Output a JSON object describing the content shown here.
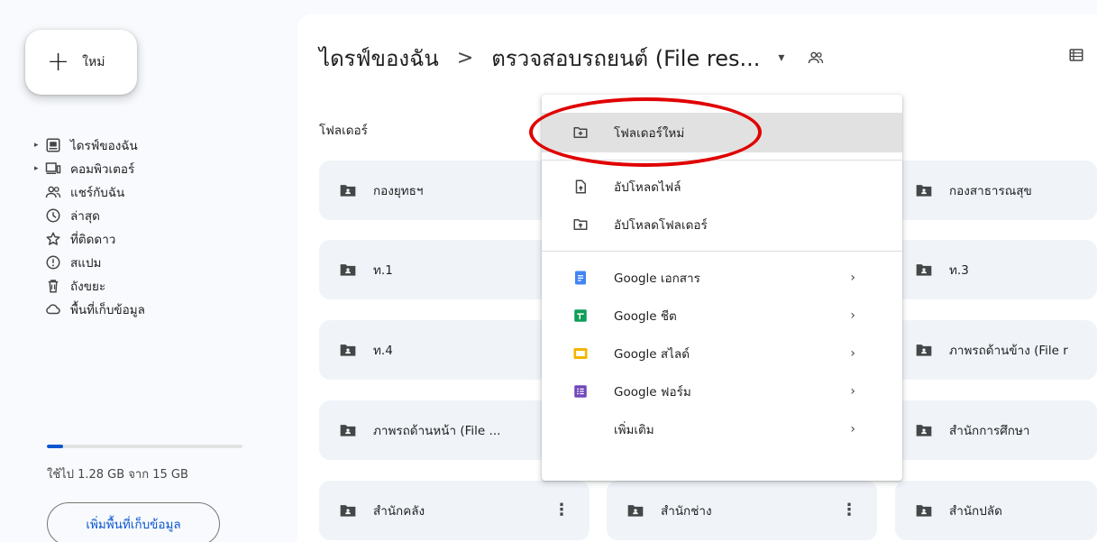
{
  "new_button": {
    "label": "ใหม่",
    "icon": "plus-icon"
  },
  "sidebar": {
    "items": [
      {
        "label": "ไดรฟ์ของฉัน",
        "icon": "my-drive-icon",
        "expandable": true
      },
      {
        "label": "คอมพิวเตอร์",
        "icon": "computer-icon",
        "expandable": true
      },
      {
        "label": "แชร์กับฉัน",
        "icon": "shared-icon",
        "expandable": false
      },
      {
        "label": "ล่าสุด",
        "icon": "clock-icon",
        "expandable": false
      },
      {
        "label": "ที่ติดดาว",
        "icon": "star-icon",
        "expandable": false
      },
      {
        "label": "สแปม",
        "icon": "spam-icon",
        "expandable": false
      },
      {
        "label": "ถังขยะ",
        "icon": "trash-icon",
        "expandable": false
      },
      {
        "label": "พื้นที่เก็บข้อมูล",
        "icon": "cloud-icon",
        "expandable": false
      }
    ],
    "storage_used_fraction": 0.085,
    "storage_text": "ใช้ไป 1.28 GB จาก 15 GB",
    "upgrade_label": "เพิ่มพื้นที่เก็บข้อมูล"
  },
  "header": {
    "root": "ไดรฟ์ของฉัน",
    "separator": ">",
    "current": "ตรวจสอบรถยนต์ (File res...",
    "dropdown_icon": "▾"
  },
  "folders_section": {
    "title": "โฟลเดอร์",
    "folders": [
      {
        "name": "กองยุทธฯ"
      },
      {
        "name": "กองสาธารณสุข"
      },
      {
        "name": "ท.1"
      },
      {
        "name": "ท.3"
      },
      {
        "name": "ท.4"
      },
      {
        "name": "ภาพรถด้านข้าง (File r"
      },
      {
        "name": "ภาพรถด้านหน้า (File ..."
      },
      {
        "name": "สำนักการศึกษา"
      },
      {
        "name": "สำนักคลัง"
      },
      {
        "name": "สำนักช่าง"
      },
      {
        "name": "สำนักปลัด"
      }
    ],
    "more_icon": "⋮"
  },
  "context_menu": {
    "items": [
      {
        "label": "โฟลเดอร์ใหม่",
        "icon": "new-folder-icon"
      },
      {
        "label": "อัปโหลดไฟล์",
        "icon": "upload-file-icon"
      },
      {
        "label": "อัปโหลดโฟลเดอร์",
        "icon": "upload-folder-icon"
      },
      {
        "label": "Google เอกสาร",
        "icon": "google-docs-icon"
      },
      {
        "label": "Google ชีต",
        "icon": "google-sheets-icon"
      },
      {
        "label": "Google สไลด์",
        "icon": "google-slides-icon"
      },
      {
        "label": "Google ฟอร์ม",
        "icon": "google-forms-icon"
      },
      {
        "label": "เพิ่มเติม"
      }
    ],
    "submenu_arrow": "›"
  },
  "colors": {
    "accent": "#0b57d0",
    "docs": "#4285f4",
    "sheets": "#0f9d58",
    "slides": "#f4b400",
    "forms": "#7248b9",
    "annotation_ring": "#e00000"
  }
}
